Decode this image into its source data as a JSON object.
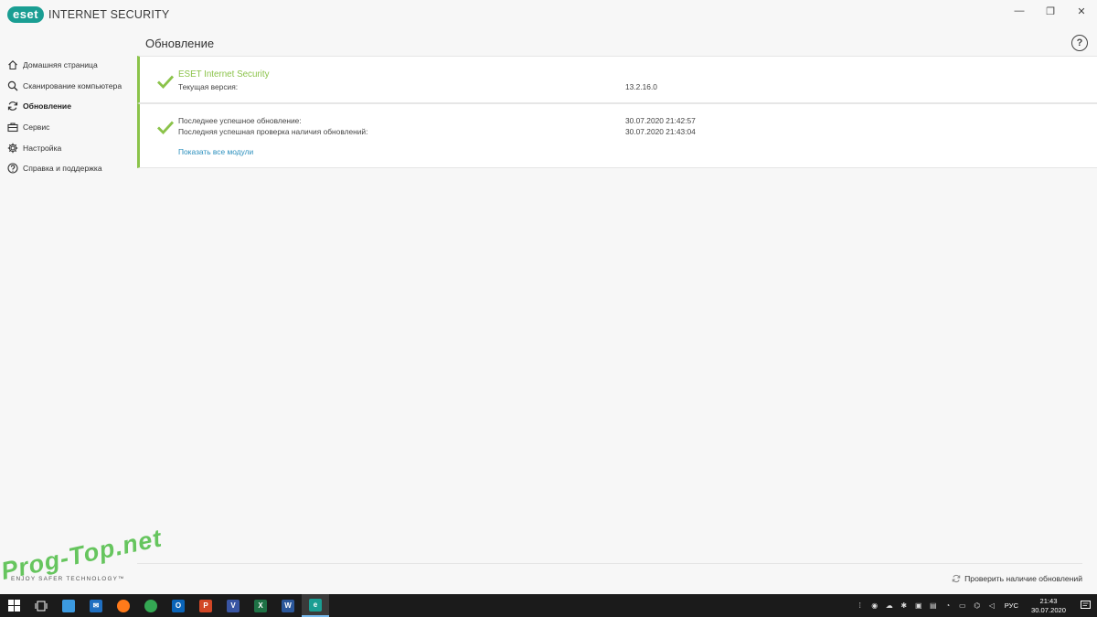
{
  "app": {
    "logo_badge": "eset",
    "logo_text": "INTERNET SECURITY",
    "brand_color": "#1a9e93",
    "accent_green": "#8bc34a",
    "link_color": "#2a8fbd"
  },
  "window_controls": {
    "minimize": "—",
    "restore": "❐",
    "close": "✕"
  },
  "sidebar": {
    "items": [
      {
        "label": "Домашняя страница",
        "icon": "home-icon",
        "active": false
      },
      {
        "label": "Сканирование компьютера",
        "icon": "search-icon",
        "active": false
      },
      {
        "label": "Обновление",
        "icon": "refresh-icon",
        "active": true
      },
      {
        "label": "Сервис",
        "icon": "briefcase-icon",
        "active": false
      },
      {
        "label": "Настройка",
        "icon": "gear-icon",
        "active": false
      },
      {
        "label": "Справка и поддержка",
        "icon": "help-icon",
        "active": false
      }
    ]
  },
  "main": {
    "title": "Обновление",
    "help": "?",
    "product": {
      "name": "ESET Internet Security",
      "version_label": "Текущая версия:",
      "version_value": "13.2.16.0"
    },
    "updates": {
      "last_update_label": "Последнее успешное обновление:",
      "last_update_value": "30.07.2020 21:42:57",
      "last_check_label": "Последняя успешная проверка наличия обновлений:",
      "last_check_value": "30.07.2020 21:43:04",
      "show_modules_link": "Показать все модули"
    }
  },
  "footer": {
    "tagline": "ENJOY SAFER TECHNOLOGY™",
    "watermark": "Prog-Top.net",
    "check_updates": "Проверить наличие обновлений"
  },
  "taskbar": {
    "apps": [
      {
        "name": "explorer-app",
        "letter": "",
        "color": "#3c9ae0"
      },
      {
        "name": "mail-app",
        "letter": "✉",
        "color": "#1f6fc1"
      },
      {
        "name": "firefox-app",
        "letter": "",
        "color": "#ff7a1a"
      },
      {
        "name": "chrome-app",
        "letter": "",
        "color": "#34a853"
      },
      {
        "name": "outlook-app",
        "letter": "O",
        "color": "#0a64b8"
      },
      {
        "name": "powerpoint-app",
        "letter": "P",
        "color": "#d24726"
      },
      {
        "name": "visio-app",
        "letter": "V",
        "color": "#3955a3"
      },
      {
        "name": "excel-app",
        "letter": "X",
        "color": "#1e7145"
      },
      {
        "name": "word-app",
        "letter": "W",
        "color": "#2b579a"
      },
      {
        "name": "eset-app",
        "letter": "e",
        "color": "#1a9e93"
      }
    ],
    "language": "РУС",
    "time": "21:43",
    "date": "30.07.2020"
  }
}
